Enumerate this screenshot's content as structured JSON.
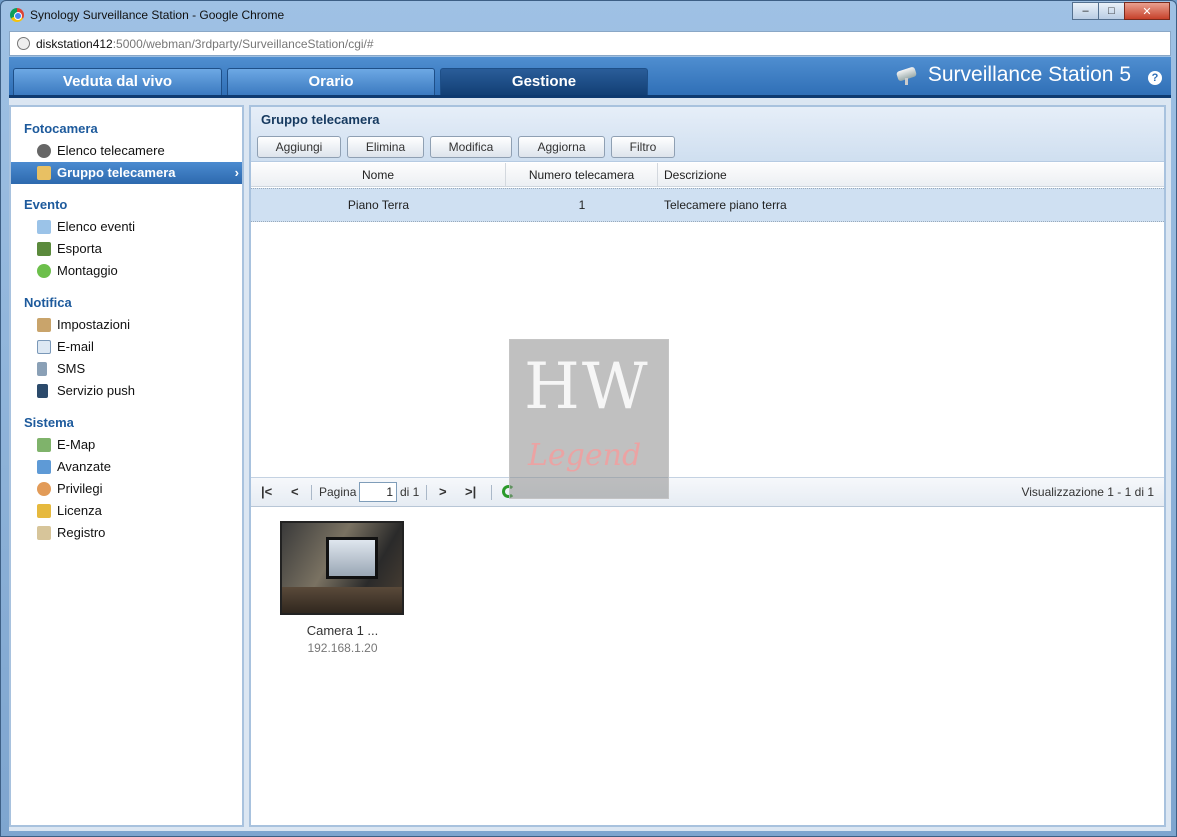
{
  "window": {
    "title": "Synology Surveillance Station - Google Chrome",
    "url_host": "diskstation412",
    "url_rest": ":5000/webman/3rdparty/SurveillanceStation/cgi/#",
    "minimize": "–",
    "maximize": "□",
    "close": "✕"
  },
  "tabs": [
    {
      "label": "Veduta dal vivo"
    },
    {
      "label": "Orario"
    },
    {
      "label": "Gestione"
    }
  ],
  "brand": {
    "title": "Surveillance Station 5",
    "help": "?"
  },
  "sidebar": {
    "sections": [
      {
        "title": "Fotocamera",
        "items": [
          "Elenco telecamere",
          "Gruppo telecamera"
        ]
      },
      {
        "title": "Evento",
        "items": [
          "Elenco eventi",
          "Esporta",
          "Montaggio"
        ]
      },
      {
        "title": "Notifica",
        "items": [
          "Impostazioni",
          "E-mail",
          "SMS",
          "Servizio push"
        ]
      },
      {
        "title": "Sistema",
        "items": [
          "E-Map",
          "Avanzate",
          "Privilegi",
          "Licenza",
          "Registro"
        ]
      }
    ],
    "selected_chevron": "›"
  },
  "panel": {
    "title": "Gruppo telecamera",
    "buttons": [
      "Aggiungi",
      "Elimina",
      "Modifica",
      "Aggiorna",
      "Filtro"
    ],
    "columns": [
      "Nome",
      "Numero telecamera",
      "Descrizione"
    ],
    "rows": [
      {
        "nome": "Piano Terra",
        "numero": "1",
        "descrizione": "Telecamere piano terra"
      }
    ]
  },
  "pager": {
    "first": "|<",
    "prev": "<",
    "page_label": "Pagina",
    "page_value": "1",
    "of_label": "di 1",
    "next": ">",
    "last": ">|",
    "summary": "Visualizzazione 1 - 1 di 1"
  },
  "cameras": [
    {
      "name": "Camera 1 ...",
      "ip": "192.168.1.20"
    }
  ],
  "watermark": {
    "line1": "HW",
    "line2": "Legend"
  }
}
